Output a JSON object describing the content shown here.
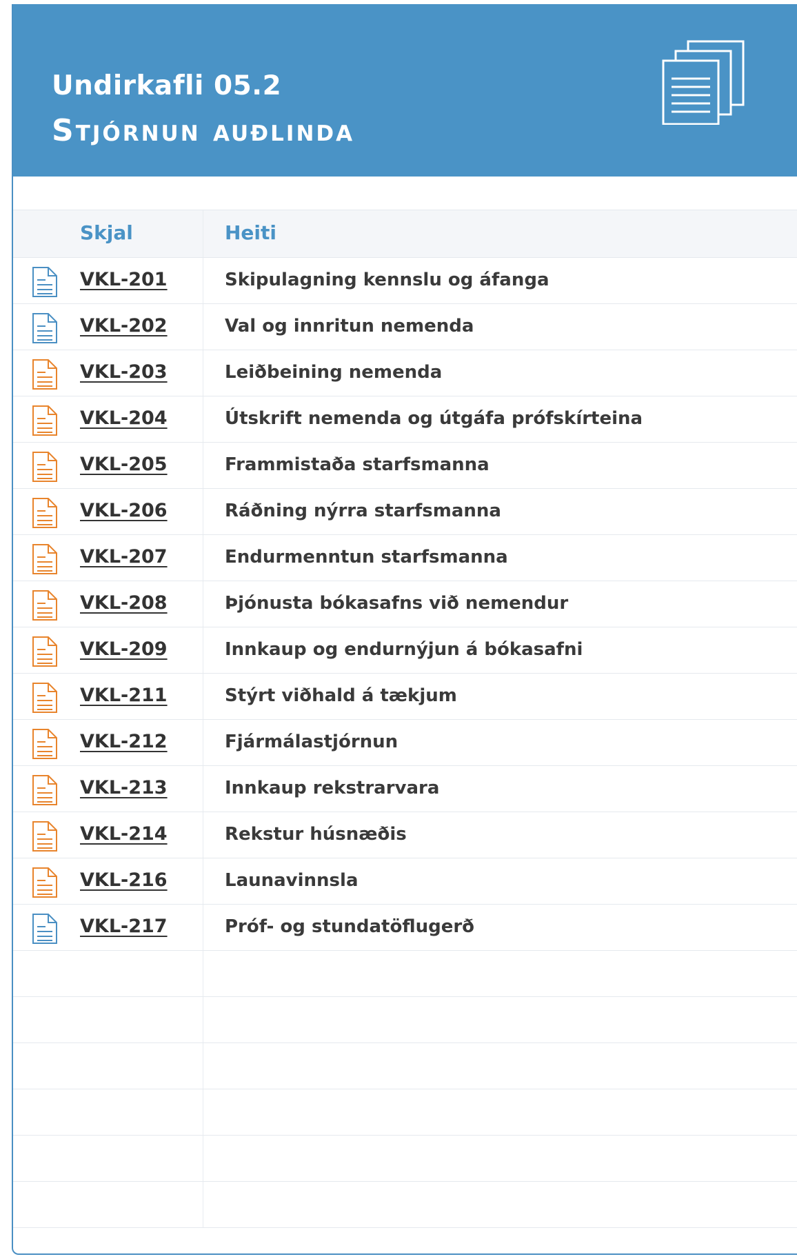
{
  "header": {
    "subtitle": "Undirkafli 05.2",
    "title": "Stjórnun auðlinda",
    "icon": "documents-stack-icon"
  },
  "table": {
    "columns": [
      "Skjal",
      "Heiti"
    ],
    "rows": [
      {
        "code": "VKL-201",
        "name": "Skipulagning kennslu og áfanga",
        "icon_color": "#4a8fc3"
      },
      {
        "code": "VKL-202",
        "name": "Val og innritun nemenda",
        "icon_color": "#4a8fc3"
      },
      {
        "code": "VKL-203",
        "name": "Leiðbeining nemenda",
        "icon_color": "#e8842c"
      },
      {
        "code": "VKL-204",
        "name": "Útskrift nemenda og útgáfa prófskírteina",
        "icon_color": "#e8842c"
      },
      {
        "code": "VKL-205",
        "name": "Frammistaða starfsmanna",
        "icon_color": "#e8842c"
      },
      {
        "code": "VKL-206",
        "name": "Ráðning nýrra starfsmanna",
        "icon_color": "#e8842c"
      },
      {
        "code": "VKL-207",
        "name": "Endurmenntun starfsmanna",
        "icon_color": "#e8842c"
      },
      {
        "code": "VKL-208",
        "name": "Þjónusta bókasafns við nemendur",
        "icon_color": "#e8842c"
      },
      {
        "code": "VKL-209",
        "name": "Innkaup og endurnýjun á bókasafni",
        "icon_color": "#e8842c"
      },
      {
        "code": "VKL-211",
        "name": "Stýrt viðhald á tækjum",
        "icon_color": "#e8842c"
      },
      {
        "code": "VKL-212",
        "name": "Fjármálastjórnun",
        "icon_color": "#e8842c"
      },
      {
        "code": "VKL-213",
        "name": "Innkaup rekstrarvara",
        "icon_color": "#e8842c"
      },
      {
        "code": "VKL-214",
        "name": "Rekstur húsnæðis",
        "icon_color": "#e8842c"
      },
      {
        "code": "VKL-216",
        "name": "Launavinnsla",
        "icon_color": "#e8842c"
      },
      {
        "code": "VKL-217",
        "name": "Próf- og stundatöflugerð",
        "icon_color": "#4a8fc3"
      }
    ]
  },
  "colors": {
    "header_bg": "#4a93c6",
    "accent_blue": "#4a8fc3",
    "accent_orange": "#e8842c"
  }
}
